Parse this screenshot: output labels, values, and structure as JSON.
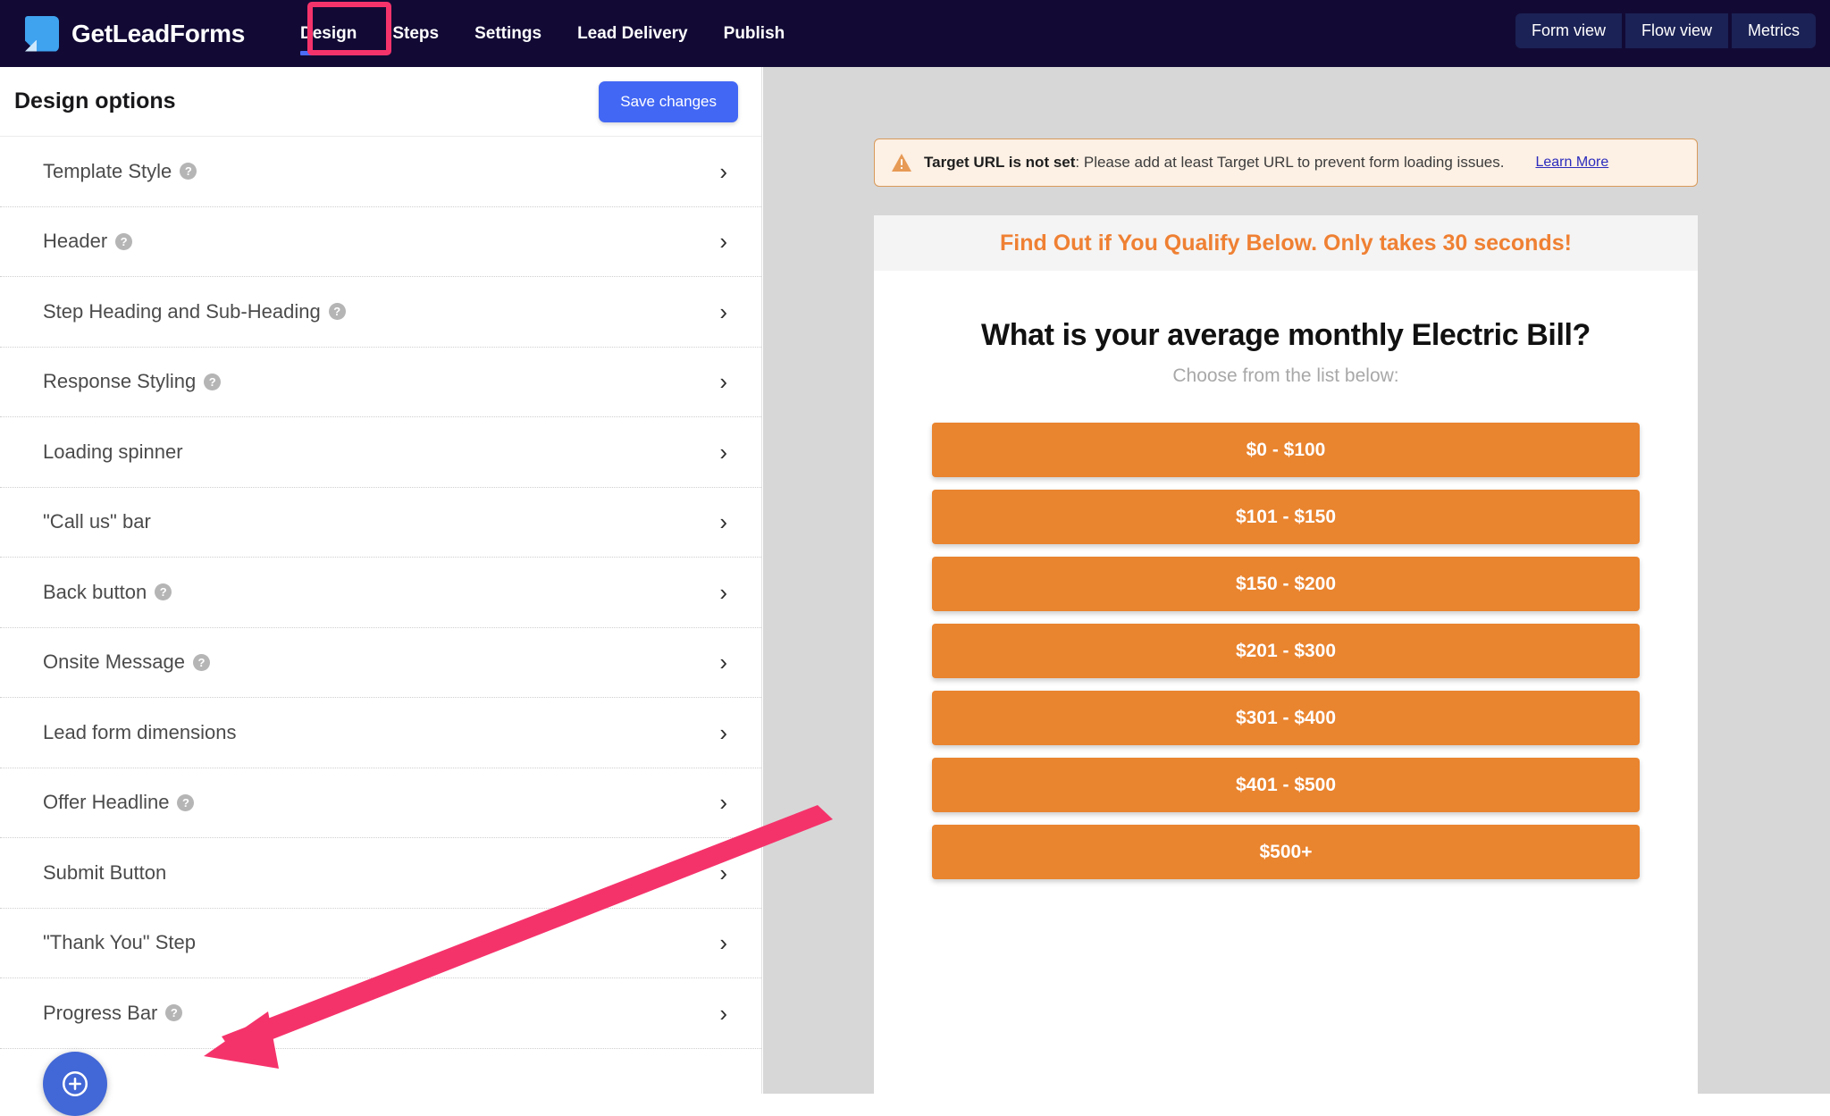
{
  "topnav": {
    "brand": "GetLeadForms",
    "logo_icon": "page-fold-logo-icon",
    "links": [
      {
        "label": "Design",
        "active": true
      },
      {
        "label": "Steps",
        "active": false
      },
      {
        "label": "Settings",
        "active": false
      },
      {
        "label": "Lead Delivery",
        "active": false
      },
      {
        "label": "Publish",
        "active": false
      }
    ],
    "view_buttons": [
      "Form view",
      "Flow view",
      "Metrics"
    ],
    "bg_color": "#120a35",
    "active_underline_color": "#4a6cf7",
    "highlight_color": "#f5336b"
  },
  "sidebar": {
    "title": "Design options",
    "save_label": "Save changes",
    "save_color": "#4267f5",
    "items": [
      {
        "label": "Template Style",
        "help": true
      },
      {
        "label": "Header",
        "help": true
      },
      {
        "label": "Step Heading and Sub-Heading",
        "help": true
      },
      {
        "label": "Response Styling",
        "help": true
      },
      {
        "label": "Loading spinner",
        "help": false
      },
      {
        "label": "\"Call us\" bar",
        "help": false
      },
      {
        "label": "Back button",
        "help": true
      },
      {
        "label": "Onsite Message",
        "help": true
      },
      {
        "label": "Lead form dimensions",
        "help": false
      },
      {
        "label": "Offer Headline",
        "help": true
      },
      {
        "label": "Submit Button",
        "help": false
      },
      {
        "label": "\"Thank You\" Step",
        "help": false
      },
      {
        "label": "Progress Bar",
        "help": true
      }
    ],
    "help_glyph": "?",
    "chevron_glyph": "›"
  },
  "chat_widget": {
    "icon": "chat-bubble-icon",
    "color": "#4267d6"
  },
  "main": {
    "alert": {
      "icon": "warning-triangle-icon",
      "bold_text": "Target URL is not set",
      "text": ": Please add at least Target URL to prevent form loading issues.",
      "link_label": "Learn More",
      "bg_color": "#fdf0e4",
      "border_color": "#d79a5a"
    },
    "form": {
      "offer_headline": "Find Out if You Qualify Below. Only takes 30 seconds!",
      "offer_headline_color": "#ef8033",
      "step_heading": "What is your average monthly Electric Bill?",
      "step_subheading": "Choose from the list below:",
      "option_color": "#e9842f",
      "options": [
        "$0 - $100",
        "$101 - $150",
        "$150 - $200",
        "$201 - $300",
        "$301 - $400",
        "$401 - $500",
        "$500+"
      ]
    }
  },
  "annotation": {
    "arrow_color": "#f5336b",
    "points_to": "Progress Bar"
  }
}
